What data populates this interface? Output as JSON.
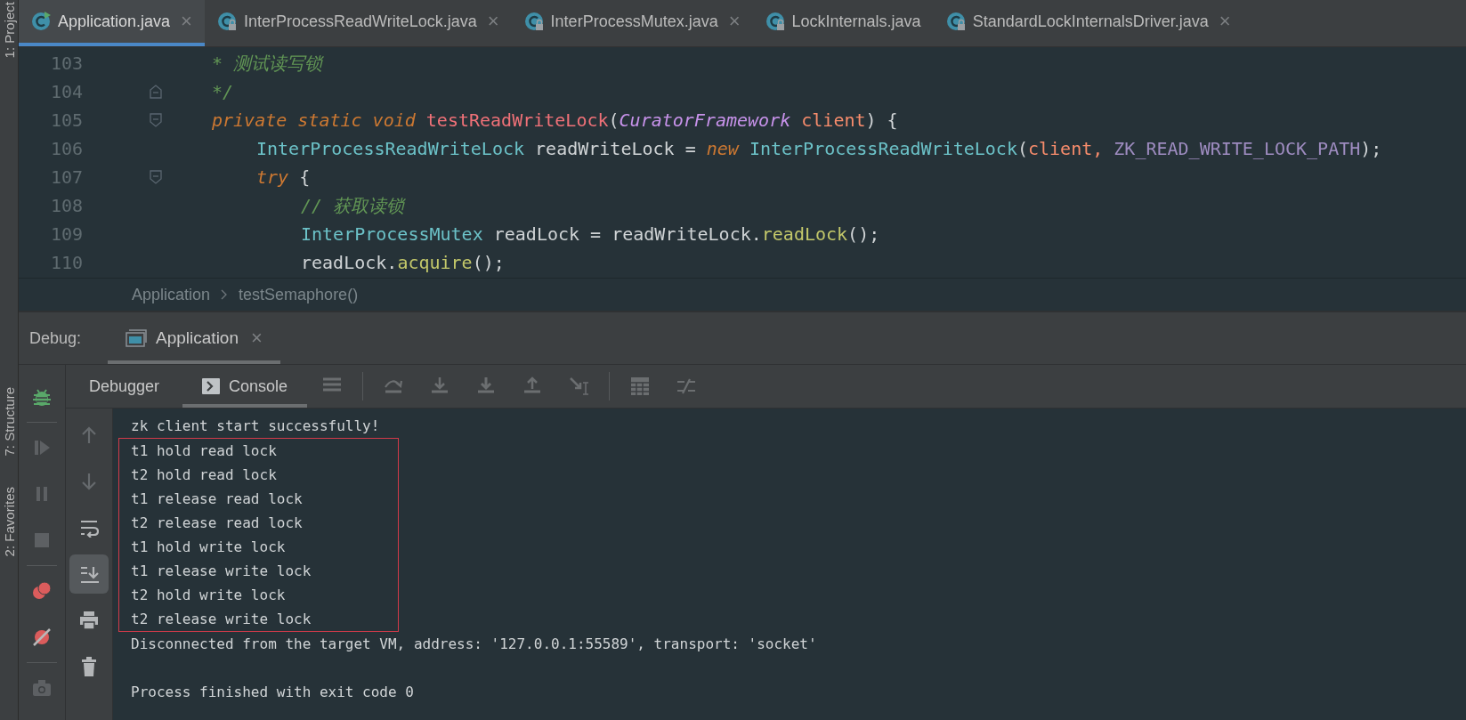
{
  "side_strip": {
    "labels": [
      {
        "text": "1: Project"
      },
      {
        "text": "7: Structure"
      },
      {
        "text": "2: Favorites"
      }
    ]
  },
  "tabs": [
    {
      "label": "Application.java",
      "selected": true,
      "close": "×",
      "kind": "runnable"
    },
    {
      "label": "InterProcessReadWriteLock.java",
      "selected": false,
      "close": "×",
      "kind": "locked"
    },
    {
      "label": "InterProcessMutex.java",
      "selected": false,
      "close": "×",
      "kind": "locked"
    },
    {
      "label": "LockInternals.java",
      "selected": false,
      "kind": "locked"
    },
    {
      "label": "StandardLockInternalsDriver.java",
      "selected": false,
      "close": "×",
      "kind": "locked"
    }
  ],
  "editor": {
    "lines": [
      {
        "number": "103",
        "fold_open": false,
        "fold_close": false,
        "tokens": [
          {
            "kind": "comment",
            "text": " * 测试读写锁"
          }
        ]
      },
      {
        "number": "104",
        "fold_open": false,
        "fold_close": true,
        "tokens": [
          {
            "kind": "comment",
            "text": " */"
          }
        ]
      },
      {
        "number": "105",
        "fold_open": true,
        "fold_close": false,
        "tokens": [
          {
            "kind": "keyword",
            "text": "private static void "
          },
          {
            "kind": "method",
            "text": "testReadWriteLock"
          },
          {
            "kind": "plain",
            "text": "("
          },
          {
            "kind": "param-type",
            "text": "CuratorFramework"
          },
          {
            "kind": "param",
            "text": " client"
          },
          {
            "kind": "plain",
            "text": ") {"
          }
        ],
        "children": [
          {
            "number": "106",
            "fold_open": false,
            "fold_close": false,
            "tokens": [
              {
                "kind": "type",
                "text": "InterProcessReadWriteLock"
              },
              {
                "kind": "plain",
                "text": " readWriteLock = "
              },
              {
                "kind": "keyword",
                "text": "new "
              },
              {
                "kind": "type",
                "text": "InterProcessReadWriteLock"
              },
              {
                "kind": "plain",
                "text": "("
              },
              {
                "kind": "param",
                "text": "client, "
              },
              {
                "kind": "constant",
                "text": "ZK_READ_WRITE_LOCK_PATH"
              },
              {
                "kind": "plain",
                "text": ");"
              }
            ]
          },
          {
            "number": "107",
            "fold_open": true,
            "fold_close": false,
            "tokens": [
              {
                "kind": "keyword",
                "text": "try "
              },
              {
                "kind": "plain",
                "text": "{"
              }
            ],
            "children": [
              {
                "number": "108",
                "fold_open": false,
                "fold_close": false,
                "tokens": [
                  {
                    "kind": "comment",
                    "text": "// 获取读锁"
                  }
                ]
              },
              {
                "number": "109",
                "fold_open": false,
                "fold_close": false,
                "tokens": [
                  {
                    "kind": "type",
                    "text": "InterProcessMutex"
                  },
                  {
                    "kind": "plain",
                    "text": " readLock = readWriteLock."
                  },
                  {
                    "kind": "call",
                    "text": "readLock"
                  },
                  {
                    "kind": "plain",
                    "text": "();"
                  }
                ]
              },
              {
                "number": "110",
                "fold_open": false,
                "fold_close": false,
                "tokens": [
                  {
                    "kind": "plain",
                    "text": "readLock."
                  },
                  {
                    "kind": "call",
                    "text": "acquire"
                  },
                  {
                    "kind": "plain",
                    "text": "();"
                  }
                ]
              }
            ]
          }
        ]
      }
    ]
  },
  "breadcrumb": [
    "Application",
    "testSemaphore()"
  ],
  "debug": {
    "label": "Debug:",
    "tabs": [
      {
        "label": "Application",
        "selected": true,
        "close": "×"
      }
    ]
  },
  "debug_tabs": [
    {
      "label": "Debugger",
      "selected": false,
      "kind": "plain"
    },
    {
      "label": "Console",
      "selected": true,
      "kind": "console"
    }
  ],
  "console_tools": [
    {
      "kind": "up",
      "on": false
    },
    {
      "kind": "down",
      "on": false
    },
    {
      "kind": "wrap",
      "on": false
    },
    {
      "kind": "scroll-end",
      "on": true
    },
    {
      "kind": "print",
      "on": false
    },
    {
      "kind": "trash",
      "on": false
    }
  ],
  "console": {
    "blocks": [
      {
        "framed": false,
        "lines": [
          "zk client start successfully!"
        ]
      },
      {
        "framed": true,
        "lines": [
          "t1 hold read lock",
          "t2 hold read lock",
          "t1 release read lock",
          "t2 release read lock",
          "t1 hold write lock",
          "t1 release write lock",
          "t2 hold write lock",
          "t2 release write lock"
        ]
      },
      {
        "framed": false,
        "lines": [
          "Disconnected from the target VM, address: '127.0.0.1:55589', transport: 'socket'"
        ]
      },
      {
        "framed": false,
        "lines": [
          "Process finished with exit code 0"
        ]
      }
    ]
  }
}
